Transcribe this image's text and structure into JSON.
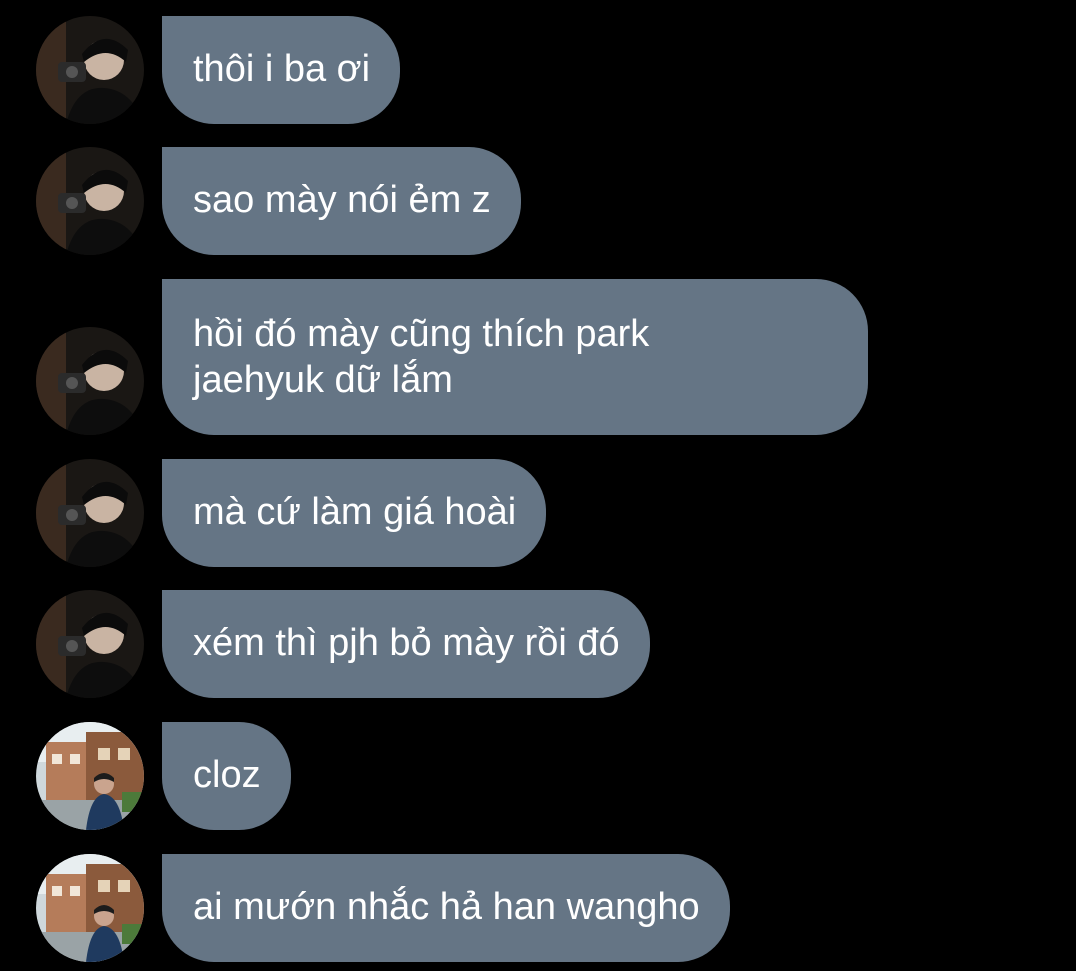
{
  "messages": [
    {
      "text": "thôi i ba ơi",
      "avatar": "dark-portrait"
    },
    {
      "text": "sao mày nói ẻm z",
      "avatar": "dark-portrait"
    },
    {
      "text": "hồi đó mày cũng thích park\njaehyuk dữ lắm",
      "avatar": "dark-portrait"
    },
    {
      "text": "mà cứ làm giá hoài",
      "avatar": "dark-portrait"
    },
    {
      "text": "xém thì pjh bỏ mày rồi đó",
      "avatar": "dark-portrait"
    },
    {
      "text": "cloz",
      "avatar": "street-portrait"
    },
    {
      "text": "ai mướn nhắc hả han wangho",
      "avatar": "street-portrait"
    }
  ],
  "colors": {
    "background": "#000000",
    "bubble": "#657585",
    "text": "#ffffff"
  }
}
